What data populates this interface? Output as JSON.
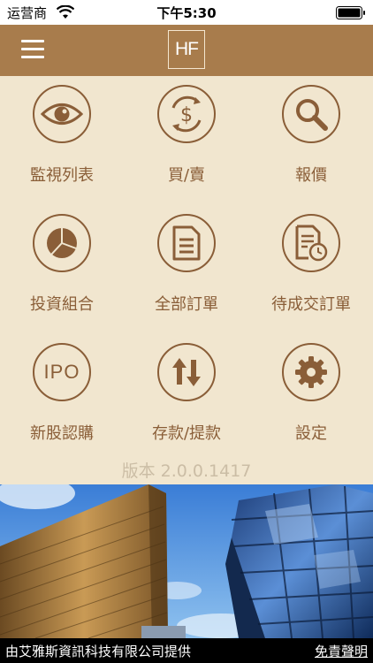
{
  "status_bar": {
    "carrier": "运营商",
    "time": "下午5:30"
  },
  "nav": {
    "logo_text": "HF"
  },
  "menu": [
    {
      "label": "監視列表",
      "icon": "eye-icon"
    },
    {
      "label": "買/賣",
      "icon": "dollar-exchange-icon"
    },
    {
      "label": "報價",
      "icon": "magnifier-icon"
    },
    {
      "label": "投資組合",
      "icon": "pie-chart-icon"
    },
    {
      "label": "全部訂單",
      "icon": "document-icon"
    },
    {
      "label": "待成交訂單",
      "icon": "pending-document-icon"
    },
    {
      "label": "新股認購",
      "icon": "ipo-icon",
      "icon_text": "IPO"
    },
    {
      "label": "存款/提款",
      "icon": "up-down-arrows-icon"
    },
    {
      "label": "設定",
      "icon": "gear-icon"
    }
  ],
  "version": "版本 2.0.0.1417",
  "footer": {
    "provider": "由艾雅斯資訊科技有限公司提供",
    "disclaimer": "免責聲明"
  },
  "colors": {
    "nav": "#a87c4c",
    "background": "#f1e6cf",
    "accent": "#8a5e38"
  }
}
